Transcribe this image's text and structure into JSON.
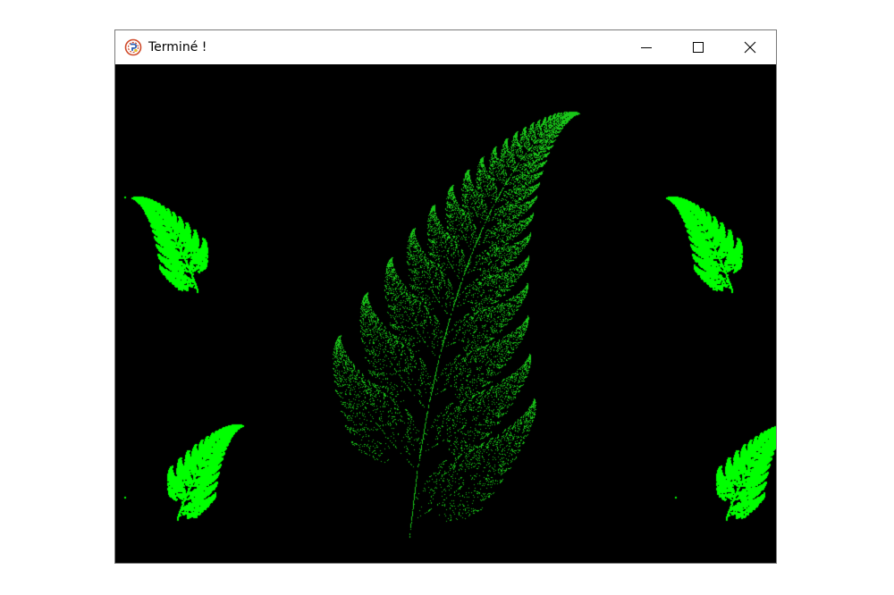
{
  "window": {
    "title": "Terminé !",
    "app_icon": "python-turtle-icon",
    "buttons": {
      "minimize": "minimize-icon",
      "maximize": "maximize-icon",
      "close": "close-icon"
    }
  },
  "colors": {
    "background": "#000000",
    "fern": "#00ff00",
    "titlebar": "#ffffff"
  }
}
